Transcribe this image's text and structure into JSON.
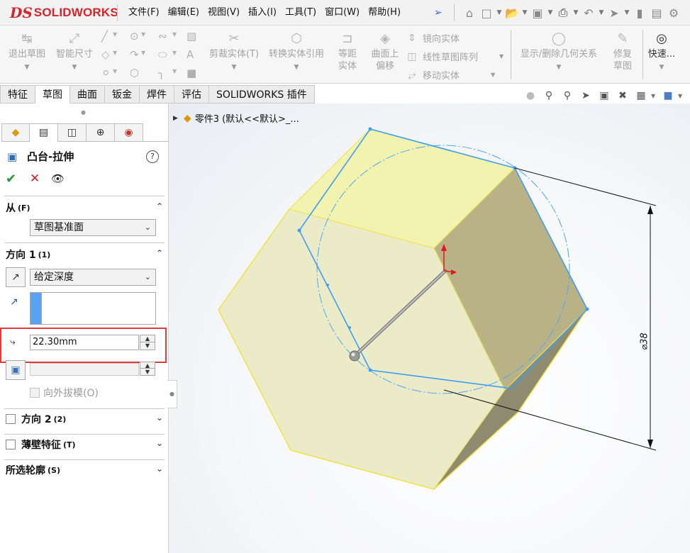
{
  "app": {
    "brand": "SOLIDWORKS",
    "brand_mark": "DS"
  },
  "menu": [
    "文件(F)",
    "编辑(E)",
    "视图(V)",
    "插入(I)",
    "工具(T)",
    "窗口(W)",
    "帮助(H)"
  ],
  "toolbar": {
    "exit_sketch": "退出草图",
    "smart_dimension": "智能尺寸",
    "trim_entities": "剪裁实体(T)",
    "convert_entities": "转换实体引用",
    "offset_entities": "等距实体",
    "offset_on_surface": "曲面上偏移",
    "mirror_entities": "镜向实体",
    "linear_pattern": "线性草图阵列",
    "move_entities": "移动实体",
    "display_relations": "显示/删除几何关系",
    "repair_sketch": "修复草图",
    "quick_snaps": "快速..."
  },
  "tabs": [
    {
      "label": "特征",
      "active": false
    },
    {
      "label": "草图",
      "active": true
    },
    {
      "label": "曲面",
      "active": false
    },
    {
      "label": "钣金",
      "active": false
    },
    {
      "label": "焊件",
      "active": false
    },
    {
      "label": "评估",
      "active": false
    },
    {
      "label": "SOLIDWORKS 插件",
      "active": false
    }
  ],
  "panel": {
    "feature_title": "凸台-拉伸",
    "help": "?",
    "from_section": {
      "label": "从",
      "shortcut": "(F)",
      "value": "草图基准面"
    },
    "direction1": {
      "label": "方向 1",
      "shortcut": "(1)",
      "end_condition": "给定深度",
      "depth": "22.30mm",
      "draft_outward": "向外拔模(O)"
    },
    "direction2": {
      "label": "方向 2",
      "shortcut": "(2)"
    },
    "thin_feature": {
      "label": "薄壁特征",
      "shortcut": "(T)"
    },
    "selected_contours": {
      "label": "所选轮廓",
      "shortcut": "(S)"
    }
  },
  "tree": {
    "node_label": "零件3 (默认<<默认>_..."
  },
  "dimension": {
    "text": "⌀38"
  },
  "colors": {
    "accent_red": "#d8232a",
    "sketch_blue": "#3d9df3",
    "face_yellow": "#efefb5",
    "highlight_red": "#e23b3b"
  }
}
